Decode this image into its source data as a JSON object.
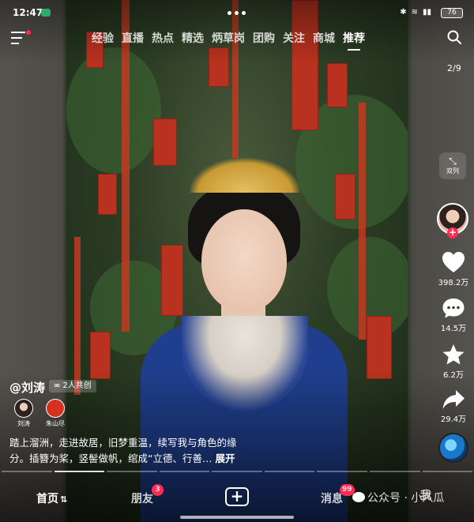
{
  "status_bar": {
    "time": "12:47",
    "battery": "76"
  },
  "top_nav": {
    "tabs": [
      {
        "label": "经验"
      },
      {
        "label": "直播"
      },
      {
        "label": "热点"
      },
      {
        "label": "精选"
      },
      {
        "label": "炳草岗"
      },
      {
        "label": "团购"
      },
      {
        "label": "关注"
      },
      {
        "label": "商城"
      },
      {
        "label": "推荐",
        "active": true
      }
    ],
    "counter": "2/9"
  },
  "side_actions": {
    "dual_label": "双列",
    "likes": "398.2万",
    "comments": "14.5万",
    "favorites": "6.2万",
    "shares": "29.4万"
  },
  "post": {
    "author": "@刘涛",
    "co_create": "2人共创",
    "creators": [
      {
        "name": "刘涛"
      },
      {
        "name": "朱山尽"
      }
    ],
    "description": "踏上溜洲，走进故居，旧梦重温，续写我与角色的缘分。插簪为桨，竖髻做帆，绾成“立德、行善…",
    "expand": "展开"
  },
  "bottom_nav": {
    "home": "首页",
    "friends": "朋友",
    "friends_badge": "3",
    "messages": "消息",
    "messages_badge": "99",
    "me": "我"
  },
  "watermark": "公众号 · 小八瓜",
  "colors": {
    "accent": "#ff2d55",
    "like": "#ffffff"
  }
}
